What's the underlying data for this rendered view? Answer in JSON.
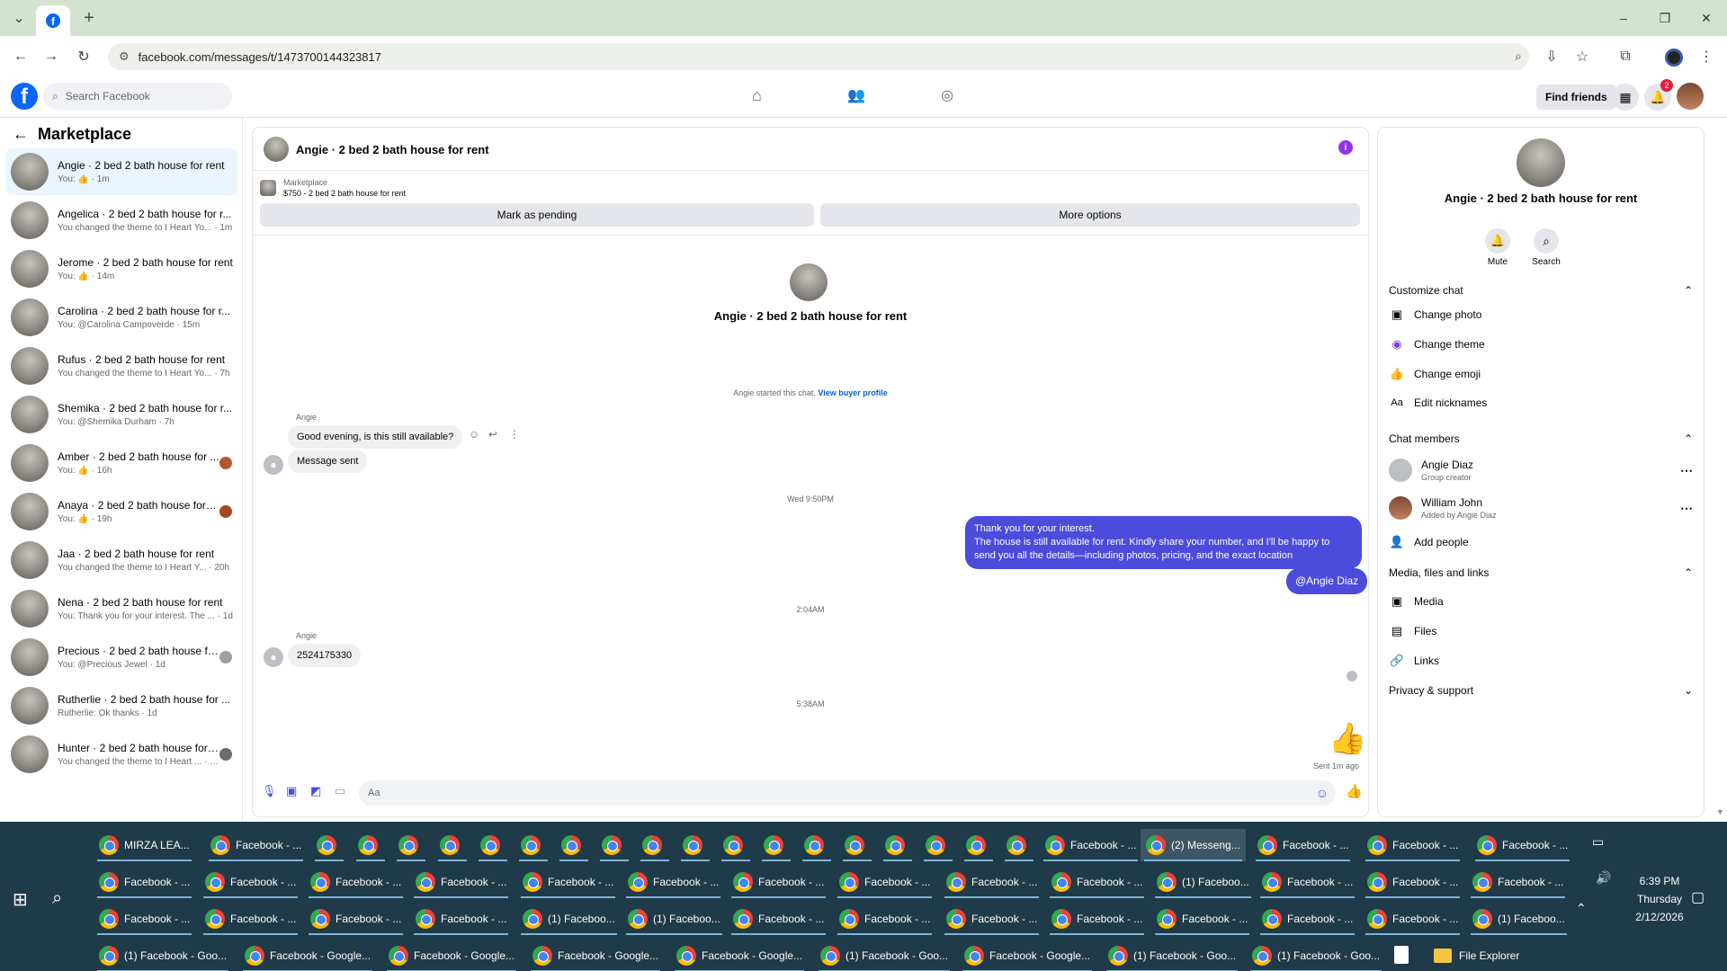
{
  "browser": {
    "tab_title": "",
    "url": "facebook.com/messages/t/1473700144323817"
  },
  "fb_header": {
    "search_placeholder": "Search Facebook",
    "find_friends": "Find friends",
    "notif_count": "2"
  },
  "left": {
    "title": "Marketplace",
    "conversations": [
      {
        "title": "Angie · 2 bed 2 bath house for rent",
        "sub": "You: 👍 · 1m",
        "active": true
      },
      {
        "title": "Angelica · 2 bed 2 bath house for r...",
        "sub": "You changed the theme to I Heart Yo... · 1m"
      },
      {
        "title": "Jerome · 2 bed 2 bath house for rent",
        "sub": "You: 👍 · 14m"
      },
      {
        "title": "Carolina · 2 bed 2 bath house for r...",
        "sub": "You: @Carolina Campoverde · 15m"
      },
      {
        "title": "Rufus · 2 bed 2 bath house for rent",
        "sub": "You changed the theme to I Heart Yo... · 7h"
      },
      {
        "title": "Shemika · 2 bed 2 bath house for r...",
        "sub": "You: @Shemika Durham · 7h"
      },
      {
        "title": "Amber · 2 bed 2 bath house for ...",
        "sub": "You: 👍 · 16h"
      },
      {
        "title": "Anaya · 2 bed 2 bath house for r...",
        "sub": "You: 👍 · 19h"
      },
      {
        "title": "Jaa · 2 bed 2 bath house for rent",
        "sub": "You changed the theme to I Heart Y... · 20h"
      },
      {
        "title": "Nena · 2 bed 2 bath house for rent",
        "sub": "You: Thank you for your interest. The ... · 1d"
      },
      {
        "title": "Precious · 2 bed 2 bath house fo...",
        "sub": "You: @Precious Jewel · 1d"
      },
      {
        "title": "Rutherlie · 2 bed 2 bath house for ...",
        "sub": "Rutherlie: Ok thanks · 1d"
      },
      {
        "title": "Hunter · 2 bed 2 bath house for ...",
        "sub": "You changed the theme to I Heart ... · 2d"
      }
    ]
  },
  "chat": {
    "title": "Angie · 2 bed 2 bath house for rent",
    "listing_label": "Marketplace",
    "listing_price": "$750 - 2 bed 2 bath house for rent",
    "mark_pending": "Mark as pending",
    "more_options": "More options",
    "hero_name": "Angie · 2 bed 2 bath house for rent",
    "started_text": "Angie started this chat.",
    "view_profile": "View buyer profile",
    "sender1": "Angie",
    "msg1": "Good evening, is this still available?",
    "msg2": "Message sent",
    "ts1": "Wed 9:50PM",
    "my_msg_line1": "Thank you for your interest.",
    "my_msg_line2": "The house is still available for rent. Kindly share your number, and I'll be happy to send you all the details—including photos, pricing, and the exact location",
    "mention": "@Angie Diaz",
    "ts2": "2:04AM",
    "sender2": "Angie",
    "msg3": "2524175330",
    "ts3": "5:38AM",
    "sent_status": "Sent 1m ago",
    "composer_placeholder": "Aa"
  },
  "right": {
    "name": "Angie · 2 bed 2 bath house for rent",
    "mute": "Mute",
    "search": "Search",
    "customize": "Customize chat",
    "change_photo": "Change photo",
    "change_theme": "Change theme",
    "change_emoji": "Change emoji",
    "edit_nicknames": "Edit nicknames",
    "members": "Chat members",
    "member1_name": "Angie Diaz",
    "member1_role": "Group creator",
    "member2_name": "William John",
    "member2_role": "Added by Angie Diaz",
    "add_people": "Add people",
    "media_section": "Media, files and links",
    "media": "Media",
    "files": "Files",
    "links": "Links",
    "privacy": "Privacy & support"
  },
  "taskbar": {
    "row1": [
      "MIRZA LEA...",
      "Facebook - ...",
      "",
      "",
      "",
      "",
      "",
      "",
      "",
      "",
      "",
      "",
      "",
      "",
      "",
      "",
      "",
      "",
      "",
      "",
      "Facebook - ...",
      "(2) Messeng...",
      "Facebook - ...",
      "Facebook - ...",
      "Facebook - ..."
    ],
    "row2": [
      "Facebook - ...",
      "Facebook - ...",
      "Facebook - ...",
      "Facebook - ...",
      "Facebook - ...",
      "Facebook - ...",
      "Facebook - ...",
      "Facebook - ...",
      "Facebook - ...",
      "Facebook - ...",
      "(1) Faceboo...",
      "Facebook - ...",
      "Facebook - ...",
      "Facebook - ..."
    ],
    "row3": [
      "Facebook - ...",
      "Facebook - ...",
      "Facebook - ...",
      "Facebook - ...",
      "(1) Faceboo...",
      "(1) Faceboo...",
      "Facebook - ...",
      "Facebook - ...",
      "Facebook - ...",
      "Facebook - ...",
      "Facebook - ...",
      "Facebook - ...",
      "Facebook - ...",
      "(1) Faceboo..."
    ],
    "row4": [
      "(1) Facebook - Goo...",
      "Facebook - Google...",
      "Facebook - Google...",
      "Facebook - Google...",
      "Facebook - Google...",
      "(1) Facebook - Goo...",
      "Facebook - Google...",
      "(1) Facebook - Goo...",
      "(1) Facebook - Goo..."
    ],
    "file_explorer": "File Explorer",
    "time": "6:39 PM",
    "day": "Thursday",
    "date": "2/12/2026"
  }
}
